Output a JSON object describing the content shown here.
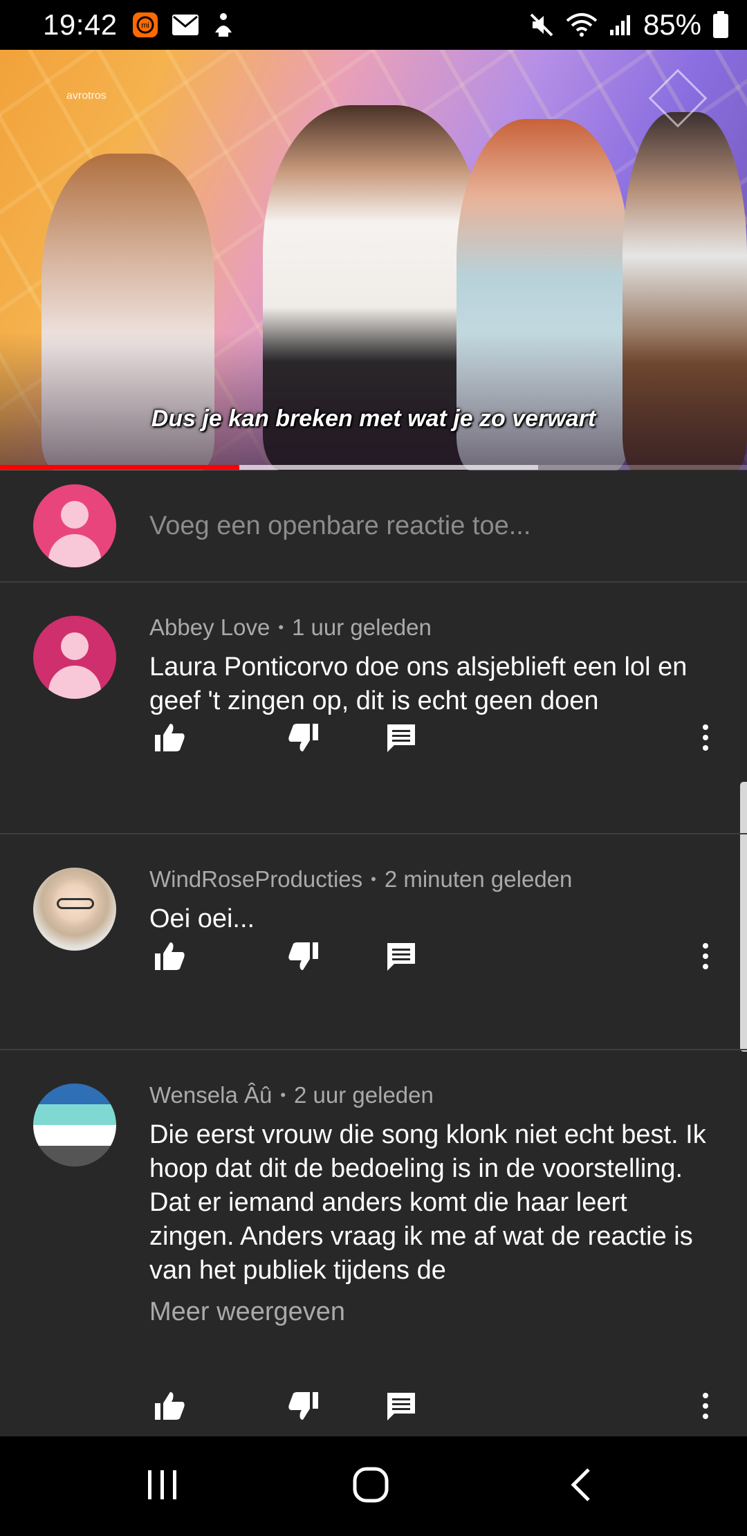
{
  "status_bar": {
    "time": "19:42",
    "battery": "85%",
    "left_icons": [
      "app-notification-icon",
      "mail-icon",
      "accessibility-icon"
    ],
    "right_icons": [
      "mute-icon",
      "wifi-icon",
      "signal-icon",
      "battery-icon"
    ]
  },
  "video": {
    "subtitle": "Dus je kan breken met wat je zo verwart",
    "logo_text": "avrotros",
    "progress_played": 0.32,
    "progress_buffered": 0.72,
    "colors": {
      "played": "#ff0000"
    }
  },
  "add_comment": {
    "placeholder": "Voeg een openbare reactie toe..."
  },
  "comments": [
    {
      "author": "Abbey Love",
      "time": "1 uur geleden",
      "text": "Laura Ponticorvo doe ons alsjeblieft een lol en geef 't zingen op, dit is echt geen doen",
      "avatar": "default-avatar-magenta"
    },
    {
      "author": "WindRoseProducties",
      "time": "2 minuten geleden",
      "text": "Oei oei...",
      "avatar": "photo-avatar"
    },
    {
      "author": "Wensela Âû",
      "time": "2 uur geleden",
      "text": "Die eerst vrouw die song klonk niet echt best. Ik hoop dat dit de bedoeling is in de voorstelling. Dat er iemand anders komt die haar leert zingen. Anders vraag ik me af wat de reactie is van het publiek tijdens de",
      "show_more": "Meer weergeven",
      "avatar": "flag-avatar"
    }
  ],
  "actions_icons": [
    "like-icon",
    "dislike-icon",
    "reply-icon",
    "more-icon"
  ],
  "colors": {
    "background": "#282828",
    "avatar_pink": "#e9457d",
    "avatar_magenta": "#cf2f6c"
  }
}
